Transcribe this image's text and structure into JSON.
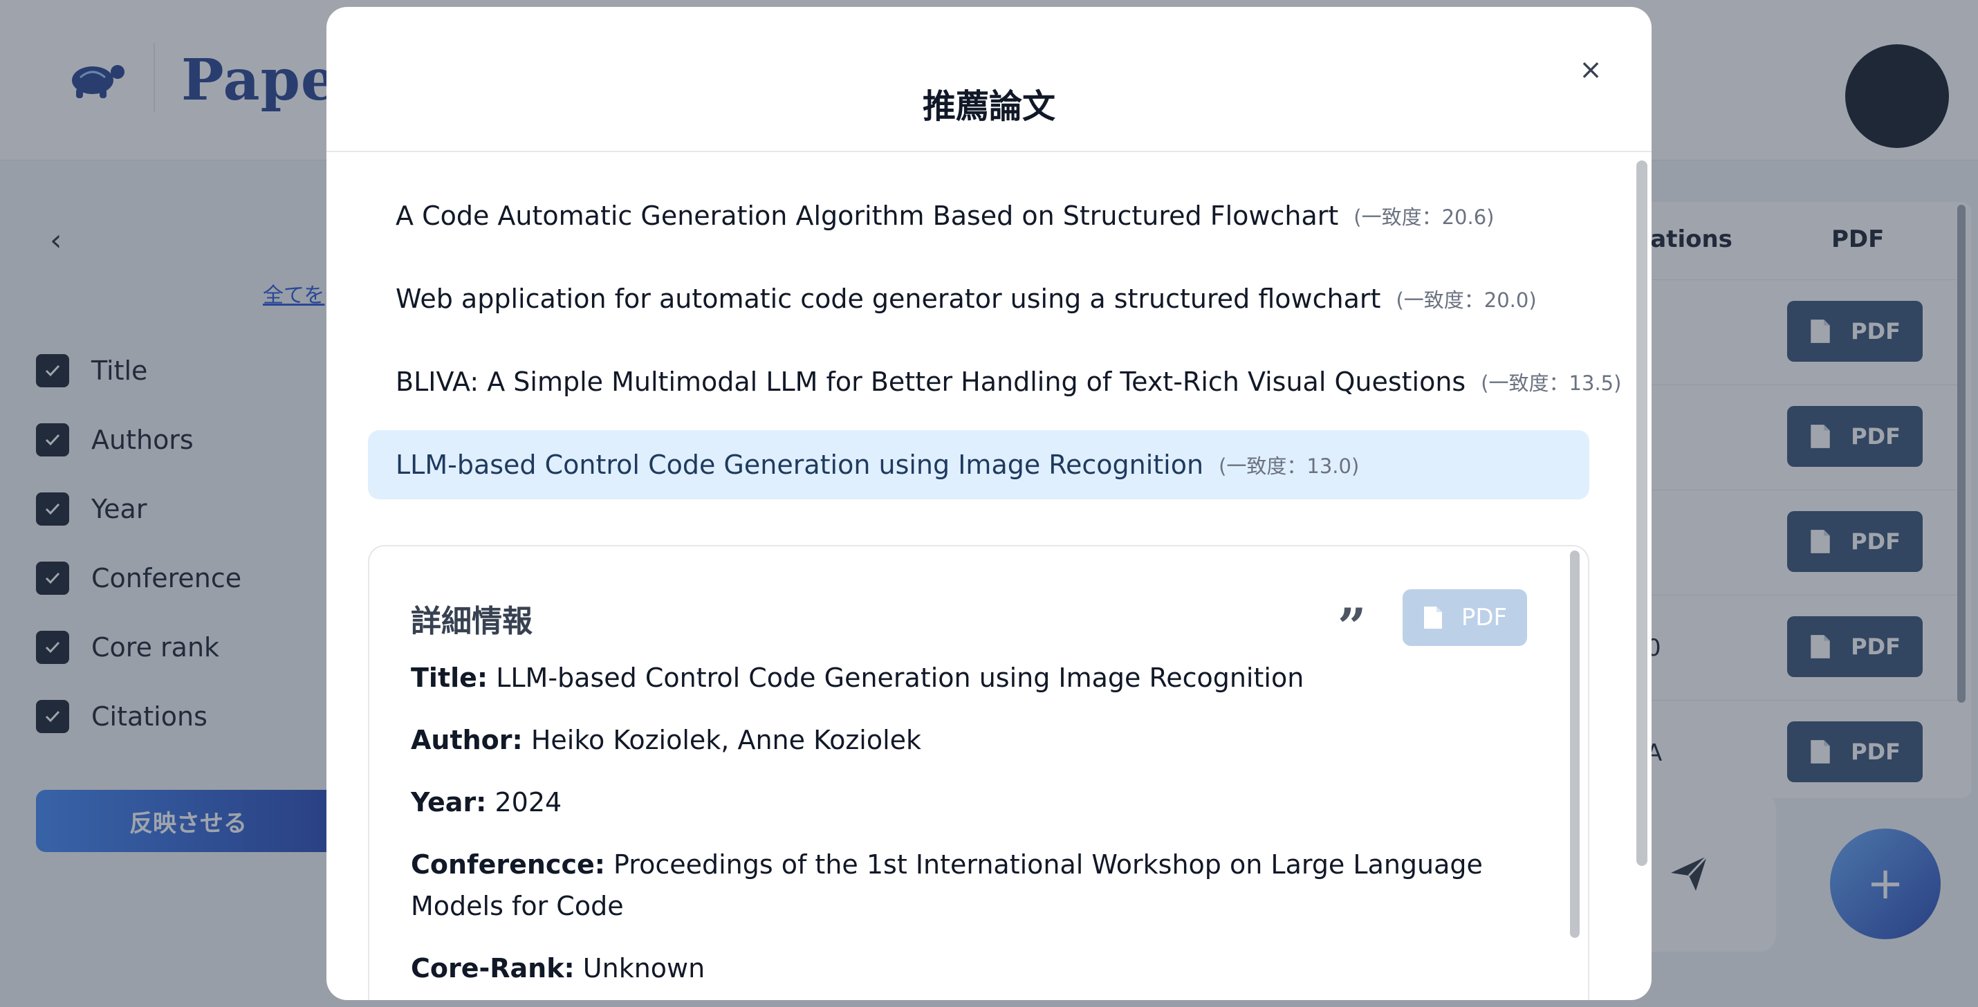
{
  "app": {
    "logo_text": "Paper",
    "select_all_link": "全てを",
    "collapse_icon": "chevron-left-icon",
    "columns": [
      {
        "label": "Title",
        "checked": true
      },
      {
        "label": "Authors",
        "checked": true
      },
      {
        "label": "Year",
        "checked": true
      },
      {
        "label": "Conference",
        "checked": true
      },
      {
        "label": "Core rank",
        "checked": true
      },
      {
        "label": "Citations",
        "checked": true
      }
    ],
    "apply_button": "反映させる",
    "table": {
      "header_citations": "tations",
      "header_pdf": "PDF",
      "rows": [
        {
          "cell": "",
          "pdf": "PDF"
        },
        {
          "cell": "",
          "pdf": "PDF"
        },
        {
          "cell": "",
          "pdf": "PDF"
        },
        {
          "cell": "0",
          "pdf": "PDF"
        },
        {
          "cell": "A",
          "pdf": "PDF"
        }
      ]
    },
    "fab_label": "+",
    "colors": {
      "accent": "#1e40af",
      "header_bg": "#ffffff",
      "overlay": "rgba(55,65,81,0.48)"
    }
  },
  "modal": {
    "title": "推薦論文",
    "close": "×",
    "papers": [
      {
        "title": "A Code Automatic Generation Algorithm Based on Structured Flowchart",
        "score": "(一致度：20.6)",
        "selected": false
      },
      {
        "title": "Web application for automatic code generator using a structured flowchart",
        "score": "(一致度：20.0)",
        "selected": false
      },
      {
        "title": "BLIVA: A Simple Multimodal LLM for Better Handling of Text-Rich Visual Questions",
        "score": "(一致度：13.5)",
        "selected": false
      },
      {
        "title": "LLM-based Control Code Generation using Image Recognition",
        "score": "(一致度：13.0)",
        "selected": true
      }
    ],
    "detail": {
      "heading": "詳細情報",
      "cite_icon": "quote-icon",
      "pdf_button": "PDF",
      "fields": [
        {
          "label": "Title:",
          "value": "LLM-based Control Code Generation using Image Recognition"
        },
        {
          "label": "Author:",
          "value": "Heiko Koziolek, Anne Koziolek"
        },
        {
          "label": "Year:",
          "value": "2024"
        },
        {
          "label": "Conferencce:",
          "value": "Proceedings of the 1st International Workshop on Large Language Models for Code"
        },
        {
          "label": "Core-Rank:",
          "value": "Unknown"
        }
      ]
    }
  }
}
